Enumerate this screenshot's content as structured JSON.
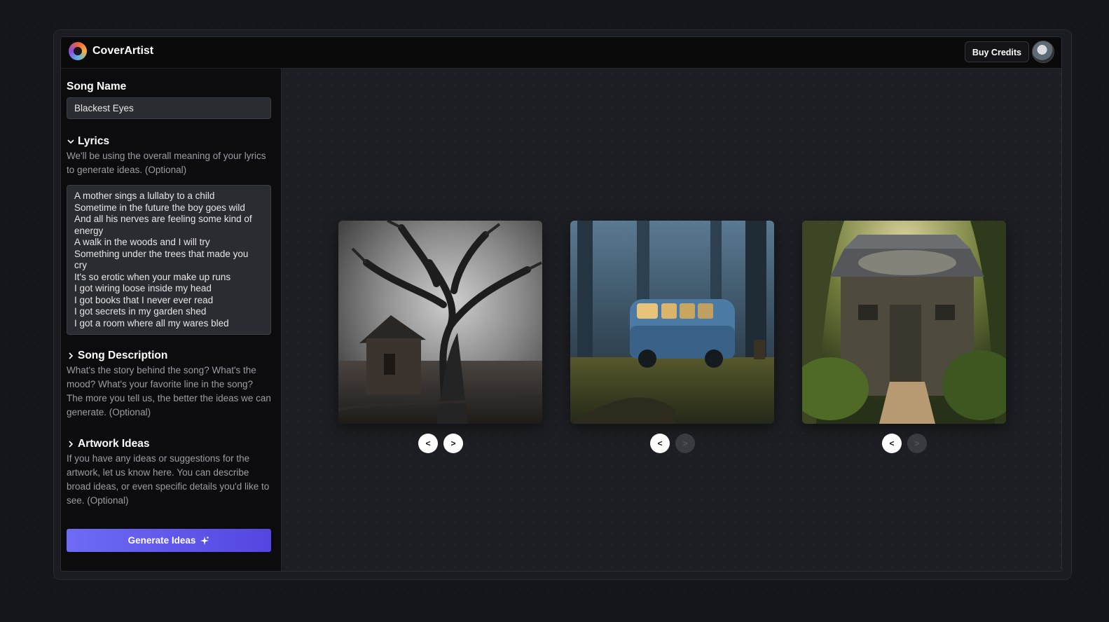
{
  "app": {
    "name": "CoverArtist",
    "logo_icon": "coverartist-logo-icon"
  },
  "header": {
    "buy_credits_label": "Buy Credits",
    "avatar_icon": "user-avatar"
  },
  "form": {
    "song_name": {
      "label": "Song Name",
      "value": "Blackest Eyes"
    },
    "lyrics": {
      "label": "Lyrics",
      "expanded": true,
      "help": "We'll be using the overall meaning of your lyrics to generate ideas. (Optional)",
      "value": "A mother sings a lullaby to a child\nSometime in the future the boy goes wild\nAnd all his nerves are feeling some kind of energy\nA walk in the woods and I will try\nSomething under the trees that made you cry\nIt's so erotic when your make up runs\nI got wiring loose inside my head\nI got books that I never ever read\nI got secrets in my garden shed\nI got a room where all my wares bled"
    },
    "song_description": {
      "label": "Song Description",
      "expanded": false,
      "help": "What's the story behind the song? What's the mood? What's your favorite line in the song? The more you tell us, the better the ideas we can generate. (Optional)"
    },
    "artwork_ideas": {
      "label": "Artwork Ideas",
      "expanded": false,
      "help": "If you have any ideas or suggestions for the artwork, let us know here. You can describe broad ideas, or even specific details you'd like to see. (Optional)"
    },
    "generate_label": "Generate Ideas",
    "generate_icon": "sparkle-icon"
  },
  "results": {
    "prev_symbol": "<",
    "next_symbol": ">",
    "cards": [
      {
        "image": "misty-tree-with-wooden-shack",
        "next_enabled": true
      },
      {
        "image": "blue-van-in-misty-forest",
        "next_enabled": false
      },
      {
        "image": "wooden-garden-shed-in-sunlight",
        "next_enabled": false
      }
    ]
  },
  "colors": {
    "accent_start": "#6e6bf5",
    "accent_end": "#5346e0",
    "canvas_bg": "#1d1e23",
    "sidebar_bg": "#0c0c0e"
  }
}
